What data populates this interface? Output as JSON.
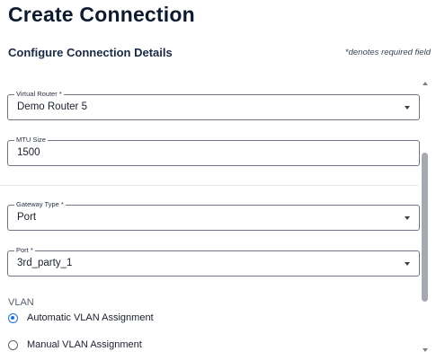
{
  "header": {
    "title": "Create Connection",
    "subtitle": "Configure Connection Details",
    "required_note": "*denotes required field"
  },
  "form": {
    "virtual_router": {
      "label": "Virtual Router *",
      "value": "Demo Router 5"
    },
    "mtu_size": {
      "label": "MTU Size",
      "value": "1500"
    },
    "gateway_type": {
      "label": "Gateway Type *",
      "value": "Port"
    },
    "port": {
      "label": "Port *",
      "value": "3rd_party_1"
    },
    "vlan": {
      "label": "VLAN",
      "options": [
        {
          "label": "Automatic VLAN Assignment",
          "selected": true
        },
        {
          "label": "Manual VLAN Assignment",
          "selected": false
        }
      ]
    }
  },
  "colors": {
    "accent": "#1f6fd1",
    "title": "#0e1a2e",
    "border": "#6e7583"
  }
}
